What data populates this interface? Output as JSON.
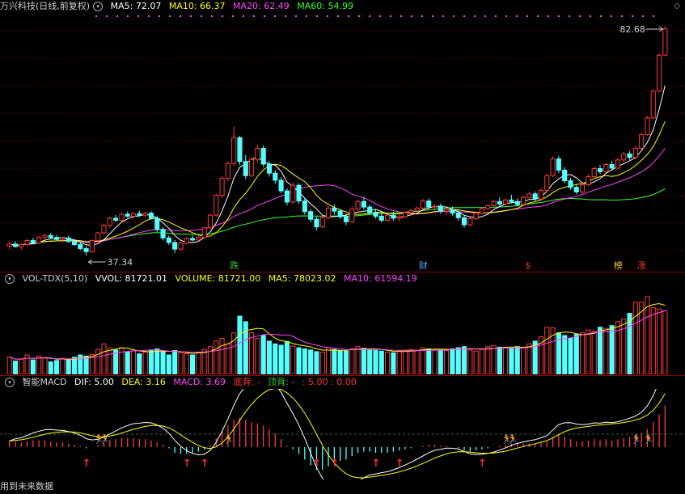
{
  "title": "万兴科技(日线,前复权)",
  "price_header": {
    "ma5": {
      "label": "MA5:",
      "value": "72.07",
      "color": "#ffffff"
    },
    "ma10": {
      "label": "MA10:",
      "value": "66.37",
      "color": "#ffff00"
    },
    "ma20": {
      "label": "MA20:",
      "value": "62.49",
      "color": "#ff44ff"
    },
    "ma60": {
      "label": "MA60:",
      "value": "54.99",
      "color": "#33ff33"
    }
  },
  "annotations": {
    "high": "82.68",
    "low": "37.34"
  },
  "event_markers": [
    {
      "label": "跌",
      "color": "#33cc33"
    },
    {
      "label": "财",
      "color": "#55aaff"
    },
    {
      "label": "$",
      "color": "#ff3333"
    },
    {
      "label": "榜",
      "color": "#ffcc33"
    },
    {
      "label": "涨",
      "color": "#ff3333"
    }
  ],
  "volume_header": {
    "name": "VOL-TDX(5,10)",
    "vvol": "VVOL: 81721.01",
    "volume": "VOLUME: 81721.00",
    "ma5": "MA5: 78023.02",
    "ma10": "MA10: 61594.19",
    "colors": {
      "vvol": "#ffffff",
      "volume": "#ffff00",
      "ma5": "#ffff00",
      "ma10": "#ff44ff"
    }
  },
  "macd_header": {
    "name": "智能MACD",
    "dif": "DIF: 5.00",
    "dea": "DEA: 3.16",
    "macd": "MACD: 3.69",
    "dibei": "底背: -",
    "dingbei": "顶背: -",
    "tail": ": 5.00 : 0.00",
    "colors": {
      "dif": "#ffffff",
      "dea": "#ffff00",
      "macd": "#ff44ff",
      "dibei": "#ff3333",
      "dingbei": "#33cc33",
      "tail": "#ff3333"
    }
  },
  "footer": "用到未来数据",
  "chart_data": {
    "type": "candlestick",
    "y_range": [
      37.34,
      82.68
    ],
    "candles": [
      {
        "o": 39.2,
        "h": 40.1,
        "l": 38.6,
        "c": 39.6
      },
      {
        "o": 39.6,
        "h": 40.2,
        "l": 38.9,
        "c": 39.1
      },
      {
        "o": 39.1,
        "h": 39.8,
        "l": 38.5,
        "c": 39.5
      },
      {
        "o": 39.5,
        "h": 40.6,
        "l": 39.2,
        "c": 40.3
      },
      {
        "o": 40.3,
        "h": 40.8,
        "l": 39.5,
        "c": 39.8
      },
      {
        "o": 39.8,
        "h": 41.2,
        "l": 39.6,
        "c": 40.9
      },
      {
        "o": 40.9,
        "h": 41.6,
        "l": 40.4,
        "c": 41.3
      },
      {
        "o": 41.3,
        "h": 41.8,
        "l": 40.6,
        "c": 40.9
      },
      {
        "o": 40.9,
        "h": 41.4,
        "l": 40.2,
        "c": 40.5
      },
      {
        "o": 40.5,
        "h": 41.1,
        "l": 39.9,
        "c": 40.8
      },
      {
        "o": 40.8,
        "h": 41.2,
        "l": 39.8,
        "c": 40.1
      },
      {
        "o": 40.1,
        "h": 40.7,
        "l": 39.2,
        "c": 39.5
      },
      {
        "o": 39.5,
        "h": 40.0,
        "l": 38.4,
        "c": 38.7
      },
      {
        "o": 38.7,
        "h": 39.2,
        "l": 37.34,
        "c": 38.1
      },
      {
        "o": 38.1,
        "h": 40.5,
        "l": 37.9,
        "c": 40.3
      },
      {
        "o": 40.3,
        "h": 42.0,
        "l": 40.1,
        "c": 41.8
      },
      {
        "o": 41.8,
        "h": 43.6,
        "l": 41.5,
        "c": 43.3
      },
      {
        "o": 43.3,
        "h": 45.0,
        "l": 42.9,
        "c": 44.7
      },
      {
        "o": 44.7,
        "h": 45.3,
        "l": 43.9,
        "c": 44.3
      },
      {
        "o": 44.3,
        "h": 45.8,
        "l": 44.0,
        "c": 45.5
      },
      {
        "o": 45.5,
        "h": 46.0,
        "l": 44.8,
        "c": 45.1
      },
      {
        "o": 45.1,
        "h": 45.9,
        "l": 44.6,
        "c": 45.6
      },
      {
        "o": 45.6,
        "h": 46.2,
        "l": 45.0,
        "c": 45.3
      },
      {
        "o": 45.3,
        "h": 46.0,
        "l": 44.9,
        "c": 45.7
      },
      {
        "o": 45.7,
        "h": 46.1,
        "l": 44.4,
        "c": 44.7
      },
      {
        "o": 44.7,
        "h": 45.2,
        "l": 42.0,
        "c": 42.5
      },
      {
        "o": 42.5,
        "h": 43.0,
        "l": 40.3,
        "c": 40.8
      },
      {
        "o": 40.8,
        "h": 41.3,
        "l": 39.4,
        "c": 39.9
      },
      {
        "o": 39.9,
        "h": 40.4,
        "l": 37.8,
        "c": 38.6
      },
      {
        "o": 38.6,
        "h": 40.1,
        "l": 38.3,
        "c": 39.8
      },
      {
        "o": 39.8,
        "h": 41.0,
        "l": 39.5,
        "c": 40.7
      },
      {
        "o": 40.7,
        "h": 41.3,
        "l": 40.1,
        "c": 40.4
      },
      {
        "o": 40.4,
        "h": 41.2,
        "l": 40.0,
        "c": 40.9
      },
      {
        "o": 40.9,
        "h": 43.0,
        "l": 40.7,
        "c": 42.8
      },
      {
        "o": 42.8,
        "h": 45.6,
        "l": 42.6,
        "c": 45.3
      },
      {
        "o": 45.3,
        "h": 49.5,
        "l": 45.0,
        "c": 49.2
      },
      {
        "o": 49.2,
        "h": 53.0,
        "l": 48.8,
        "c": 52.6
      },
      {
        "o": 52.6,
        "h": 55.9,
        "l": 52.0,
        "c": 55.5
      },
      {
        "o": 55.5,
        "h": 62.8,
        "l": 55.0,
        "c": 60.6
      },
      {
        "o": 60.6,
        "h": 61.0,
        "l": 55.2,
        "c": 55.9
      },
      {
        "o": 55.9,
        "h": 57.2,
        "l": 52.4,
        "c": 53.1
      },
      {
        "o": 53.1,
        "h": 56.7,
        "l": 52.8,
        "c": 56.3
      },
      {
        "o": 56.3,
        "h": 59.2,
        "l": 55.7,
        "c": 58.5
      },
      {
        "o": 58.5,
        "h": 59.1,
        "l": 54.8,
        "c": 55.4
      },
      {
        "o": 55.4,
        "h": 56.0,
        "l": 52.9,
        "c": 53.6
      },
      {
        "o": 53.6,
        "h": 54.2,
        "l": 51.5,
        "c": 52.2
      },
      {
        "o": 52.2,
        "h": 52.8,
        "l": 49.6,
        "c": 50.1
      },
      {
        "o": 50.1,
        "h": 50.6,
        "l": 47.2,
        "c": 47.9
      },
      {
        "o": 47.9,
        "h": 51.8,
        "l": 47.5,
        "c": 51.2
      },
      {
        "o": 51.2,
        "h": 51.6,
        "l": 47.5,
        "c": 48.1
      },
      {
        "o": 48.1,
        "h": 48.6,
        "l": 45.4,
        "c": 46.0
      },
      {
        "o": 46.0,
        "h": 46.5,
        "l": 43.9,
        "c": 44.5
      },
      {
        "o": 44.5,
        "h": 45.0,
        "l": 42.3,
        "c": 43.0
      },
      {
        "o": 43.0,
        "h": 45.2,
        "l": 42.7,
        "c": 44.8
      },
      {
        "o": 44.8,
        "h": 47.1,
        "l": 44.5,
        "c": 46.7
      },
      {
        "o": 46.7,
        "h": 47.4,
        "l": 45.4,
        "c": 46.1
      },
      {
        "o": 46.1,
        "h": 46.6,
        "l": 44.5,
        "c": 45.0
      },
      {
        "o": 45.0,
        "h": 45.6,
        "l": 43.3,
        "c": 44.0
      },
      {
        "o": 44.0,
        "h": 47.0,
        "l": 43.8,
        "c": 46.5
      },
      {
        "o": 46.5,
        "h": 48.4,
        "l": 46.2,
        "c": 48.0
      },
      {
        "o": 48.0,
        "h": 48.9,
        "l": 46.4,
        "c": 46.9
      },
      {
        "o": 46.9,
        "h": 47.4,
        "l": 45.3,
        "c": 45.8
      },
      {
        "o": 45.8,
        "h": 46.4,
        "l": 44.6,
        "c": 45.1
      },
      {
        "o": 45.1,
        "h": 45.7,
        "l": 43.8,
        "c": 44.3
      },
      {
        "o": 44.3,
        "h": 45.6,
        "l": 44.0,
        "c": 45.3
      },
      {
        "o": 45.3,
        "h": 46.0,
        "l": 44.2,
        "c": 44.7
      },
      {
        "o": 44.7,
        "h": 45.4,
        "l": 44.0,
        "c": 45.0
      },
      {
        "o": 45.0,
        "h": 46.1,
        "l": 44.7,
        "c": 45.8
      },
      {
        "o": 45.8,
        "h": 46.6,
        "l": 45.2,
        "c": 46.2
      },
      {
        "o": 46.2,
        "h": 47.0,
        "l": 45.7,
        "c": 46.7
      },
      {
        "o": 46.7,
        "h": 48.5,
        "l": 46.4,
        "c": 48.1
      },
      {
        "o": 48.1,
        "h": 48.6,
        "l": 46.5,
        "c": 46.9
      },
      {
        "o": 46.9,
        "h": 47.5,
        "l": 46.2,
        "c": 47.1
      },
      {
        "o": 47.1,
        "h": 47.6,
        "l": 45.6,
        "c": 46.1
      },
      {
        "o": 46.1,
        "h": 46.8,
        "l": 45.3,
        "c": 46.4
      },
      {
        "o": 46.4,
        "h": 47.0,
        "l": 45.2,
        "c": 45.7
      },
      {
        "o": 45.7,
        "h": 46.3,
        "l": 44.2,
        "c": 44.8
      },
      {
        "o": 44.8,
        "h": 45.3,
        "l": 42.8,
        "c": 43.4
      },
      {
        "o": 43.4,
        "h": 44.9,
        "l": 43.1,
        "c": 44.6
      },
      {
        "o": 44.6,
        "h": 46.0,
        "l": 44.3,
        "c": 45.7
      },
      {
        "o": 45.7,
        "h": 46.9,
        "l": 45.4,
        "c": 46.6
      },
      {
        "o": 46.6,
        "h": 47.5,
        "l": 46.3,
        "c": 47.2
      },
      {
        "o": 47.2,
        "h": 48.4,
        "l": 46.9,
        "c": 48.0
      },
      {
        "o": 48.0,
        "h": 48.8,
        "l": 47.1,
        "c": 47.5
      },
      {
        "o": 47.5,
        "h": 48.6,
        "l": 47.2,
        "c": 48.3
      },
      {
        "o": 48.3,
        "h": 49.3,
        "l": 47.6,
        "c": 48.0
      },
      {
        "o": 48.0,
        "h": 48.6,
        "l": 47.0,
        "c": 47.4
      },
      {
        "o": 47.4,
        "h": 49.1,
        "l": 47.1,
        "c": 48.8
      },
      {
        "o": 48.8,
        "h": 49.9,
        "l": 48.4,
        "c": 49.5
      },
      {
        "o": 49.5,
        "h": 50.0,
        "l": 48.1,
        "c": 48.5
      },
      {
        "o": 48.5,
        "h": 50.6,
        "l": 48.3,
        "c": 50.2
      },
      {
        "o": 50.2,
        "h": 53.5,
        "l": 50.0,
        "c": 53.1
      },
      {
        "o": 53.1,
        "h": 56.9,
        "l": 52.8,
        "c": 56.4
      },
      {
        "o": 56.4,
        "h": 57.0,
        "l": 53.6,
        "c": 54.2
      },
      {
        "o": 54.2,
        "h": 54.8,
        "l": 51.6,
        "c": 52.1
      },
      {
        "o": 52.1,
        "h": 52.7,
        "l": 50.3,
        "c": 50.8
      },
      {
        "o": 50.8,
        "h": 51.3,
        "l": 49.4,
        "c": 49.9
      },
      {
        "o": 49.9,
        "h": 51.7,
        "l": 49.6,
        "c": 51.3
      },
      {
        "o": 51.3,
        "h": 53.3,
        "l": 51.0,
        "c": 52.9
      },
      {
        "o": 52.9,
        "h": 54.9,
        "l": 52.6,
        "c": 54.5
      },
      {
        "o": 54.5,
        "h": 55.2,
        "l": 53.4,
        "c": 53.9
      },
      {
        "o": 53.9,
        "h": 55.7,
        "l": 53.6,
        "c": 55.3
      },
      {
        "o": 55.3,
        "h": 56.0,
        "l": 54.1,
        "c": 54.6
      },
      {
        "o": 54.6,
        "h": 56.6,
        "l": 54.3,
        "c": 56.2
      },
      {
        "o": 56.2,
        "h": 57.8,
        "l": 55.9,
        "c": 57.4
      },
      {
        "o": 57.4,
        "h": 58.0,
        "l": 56.2,
        "c": 56.7
      },
      {
        "o": 56.7,
        "h": 58.9,
        "l": 56.4,
        "c": 58.5
      },
      {
        "o": 58.5,
        "h": 61.6,
        "l": 58.2,
        "c": 61.2
      },
      {
        "o": 61.2,
        "h": 64.9,
        "l": 61.0,
        "c": 64.5
      },
      {
        "o": 64.5,
        "h": 70.2,
        "l": 64.3,
        "c": 69.8
      },
      {
        "o": 69.8,
        "h": 77.2,
        "l": 69.6,
        "c": 76.9
      },
      {
        "o": 76.9,
        "h": 82.68,
        "l": 76.7,
        "c": 82.1
      }
    ],
    "volume": [
      62,
      48,
      55,
      70,
      52,
      66,
      60,
      45,
      50,
      58,
      54,
      62,
      70,
      66,
      72,
      90,
      110,
      95,
      88,
      96,
      80,
      84,
      74,
      80,
      88,
      92,
      84,
      70,
      86,
      78,
      74,
      70,
      80,
      90,
      100,
      120,
      130,
      110,
      150,
      210,
      190,
      150,
      130,
      140,
      120,
      110,
      105,
      118,
      102,
      96,
      92,
      88,
      82,
      80,
      96,
      90,
      86,
      84,
      92,
      100,
      94,
      88,
      86,
      84,
      80,
      78,
      84,
      86,
      90,
      88,
      96,
      92,
      90,
      88,
      86,
      92,
      96,
      100,
      88,
      84,
      90,
      100,
      104,
      98,
      96,
      94,
      100,
      98,
      110,
      120,
      136,
      170,
      168,
      150,
      140,
      130,
      144,
      150,
      160,
      156,
      170,
      166,
      176,
      190,
      200,
      220,
      260,
      260,
      280,
      240,
      236,
      230
    ],
    "macd_hist": [
      0.6,
      0.5,
      0.4,
      0.5,
      0.6,
      0.6,
      0.6,
      0.5,
      0.4,
      0.4,
      0.3,
      0.2,
      0.1,
      -0.1,
      0.0,
      0.2,
      0.4,
      0.6,
      0.7,
      0.8,
      0.8,
      0.8,
      0.7,
      0.7,
      0.6,
      0.4,
      0.2,
      -0.1,
      -0.5,
      -0.6,
      -0.6,
      -0.5,
      -0.4,
      -0.2,
      0.2,
      0.8,
      1.4,
      1.9,
      2.4,
      2.6,
      2.4,
      2.2,
      2.1,
      1.9,
      1.6,
      1.2,
      0.7,
      0.1,
      -0.2,
      -0.6,
      -1.1,
      -1.6,
      -2.0,
      -2.0,
      -1.7,
      -1.4,
      -1.2,
      -1.1,
      -0.8,
      -0.5,
      -0.4,
      -0.4,
      -0.5,
      -0.5,
      -0.5,
      -0.4,
      -0.3,
      -0.2,
      -0.1,
      0.0,
      0.1,
      0.2,
      0.2,
      0.1,
      0.1,
      0.0,
      -0.1,
      -0.3,
      -0.4,
      -0.3,
      -0.2,
      -0.1,
      0.0,
      0.1,
      0.2,
      0.3,
      0.3,
      0.3,
      0.3,
      0.3,
      0.4,
      0.5,
      0.9,
      1.1,
      0.9,
      0.7,
      0.5,
      0.5,
      0.6,
      0.7,
      0.6,
      0.7,
      0.6,
      0.7,
      0.8,
      0.9,
      1.0,
      1.2,
      1.6,
      2.2,
      2.9,
      3.69
    ]
  }
}
